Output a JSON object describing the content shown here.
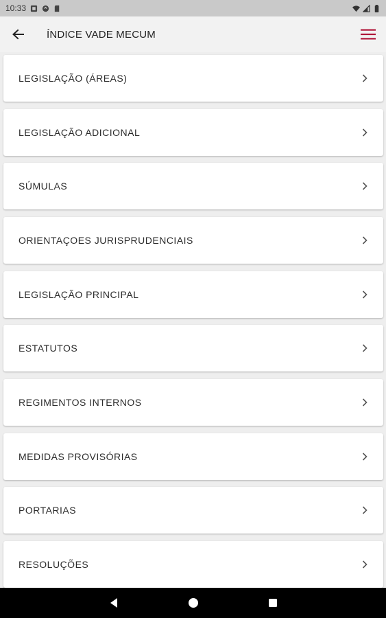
{
  "status_bar": {
    "time": "10:33",
    "left_icons": [
      "notification-icon",
      "sync-icon",
      "sd-card-icon"
    ],
    "right_icons": [
      "wifi-icon",
      "signal-icon",
      "battery-icon"
    ]
  },
  "app_bar": {
    "title": "ÍNDICE VADE MECUM",
    "accent_color": "#b0173a"
  },
  "list": {
    "items": [
      {
        "label": "LEGISLAÇÃO (ÁREAS)"
      },
      {
        "label": "LEGISLAÇÃO ADICIONAL"
      },
      {
        "label": "SÚMULAS"
      },
      {
        "label": "ORIENTAÇOES JURISPRUDENCIAIS"
      },
      {
        "label": "LEGISLAÇÃO PRINCIPAL"
      },
      {
        "label": "ESTATUTOS"
      },
      {
        "label": "REGIMENTOS INTERNOS"
      },
      {
        "label": "MEDIDAS PROVISÓRIAS"
      },
      {
        "label": "PORTARIAS"
      },
      {
        "label": "RESOLUÇÕES"
      }
    ]
  },
  "nav_bar": {
    "buttons": [
      "back-triangle-icon",
      "home-circle-icon",
      "recents-square-icon"
    ]
  }
}
